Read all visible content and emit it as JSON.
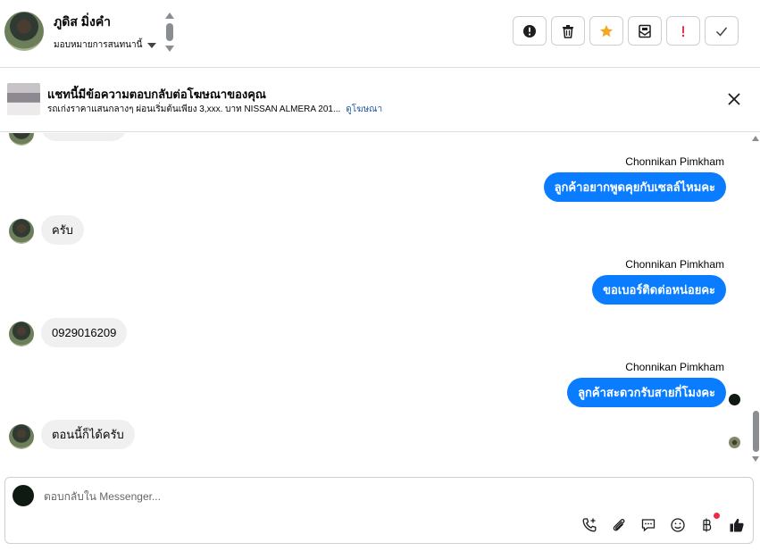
{
  "header": {
    "name": "ภูดิส มิ่งคำ",
    "assign_label": "มอบหมายการสนทนานี้",
    "actions": [
      {
        "id": "report",
        "icon": "exclamation-circle-icon"
      },
      {
        "id": "delete",
        "icon": "trash-icon"
      },
      {
        "id": "star",
        "icon": "star-icon",
        "color": "#f5a623"
      },
      {
        "id": "mark-unread",
        "icon": "envelope-icon"
      },
      {
        "id": "important",
        "icon": "exclamation-icon",
        "color": "#e41e3f"
      },
      {
        "id": "done",
        "icon": "checkmark-icon"
      }
    ]
  },
  "banner": {
    "title": "แชทนี้มีข้อความตอบกลับต่อโฆษณาของคุณ",
    "subtitle": "รถเก่งราคาแสนกลางๆ ผ่อนเริ่มต้นเพียง 3,xxx. บาท NISSAN ALMERA 201...",
    "link": "ดูโฆษณา"
  },
  "messages": {
    "m1_sender": "Chonnikan Pimkham",
    "m1_text": "ลูกค้าอยากพูดคุยกับเซลล์ไหมคะ",
    "m2_text": "ครับ",
    "m3_sender": "Chonnikan Pimkham",
    "m3_text": "ขอเบอร์ติดต่อหน่อยคะ",
    "m4_text": "0929016209",
    "m5_sender": "Chonnikan Pimkham",
    "m5_text": "ลูกค้าสะดวกรับสายกี่โมงคะ",
    "m6_text": "ตอนนี้ก็ได้ครับ"
  },
  "composer": {
    "placeholder": "ตอบกลับใน Messenger...",
    "tools": [
      "phone-plus-icon",
      "paperclip-icon",
      "speech-bubble-icon",
      "smiley-icon",
      "baht-icon",
      "thumbs-up-icon"
    ]
  },
  "colors": {
    "outgoing": "#0a7cff",
    "incoming": "#f0f0f0",
    "link": "#1f5aa3",
    "star": "#f5a623",
    "alert": "#e41e3f"
  }
}
